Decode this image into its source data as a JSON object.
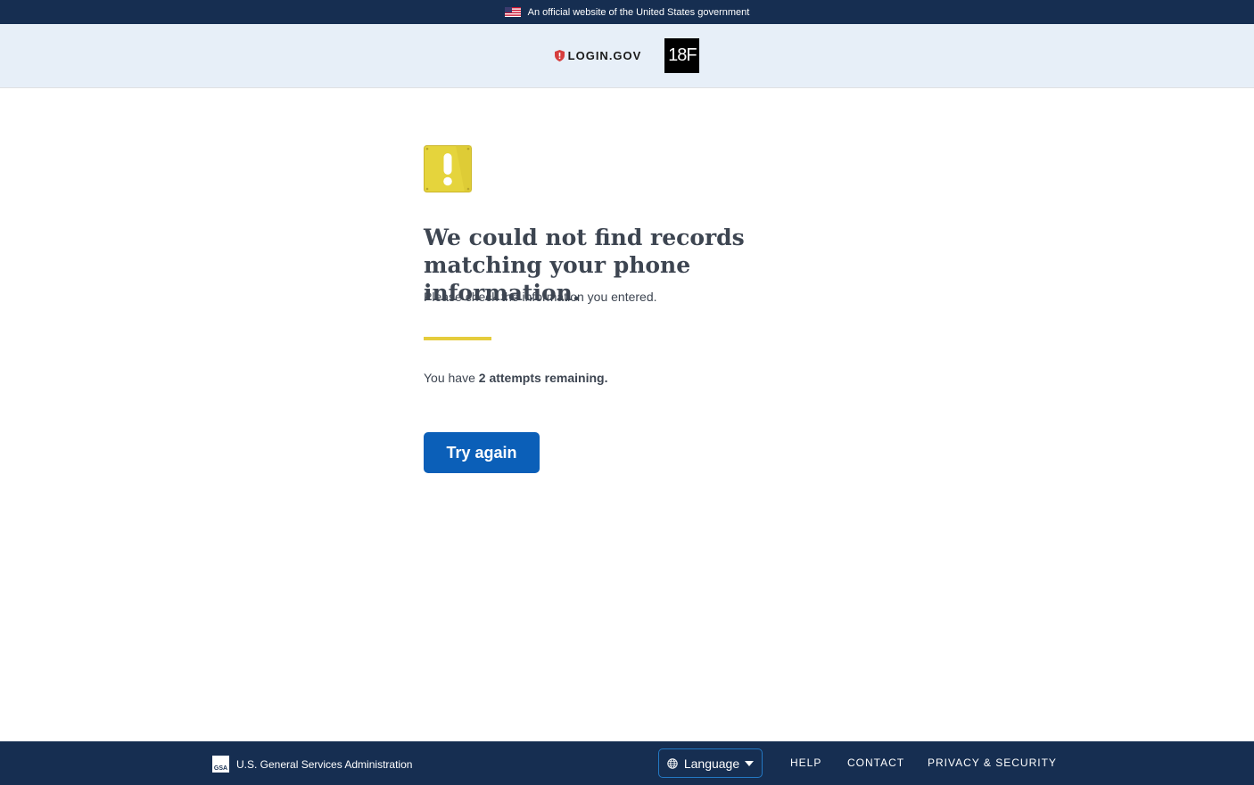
{
  "gov_banner": {
    "text": "An official website of the United States government"
  },
  "header": {
    "login_logo_text": "LOGIN.GOV",
    "partner_logo_text": "18F"
  },
  "main": {
    "heading": "We could not find records matching your phone information.",
    "subtext": "Please check the information you entered.",
    "attempts_prefix": "You have ",
    "attempts_bold": "2 attempts remaining.",
    "try_again_label": "Try again"
  },
  "footer": {
    "gsa_logo_text": "GSA",
    "gsa_text": "U.S. General Services Administration",
    "language_label": "Language",
    "links": [
      {
        "label": "Help"
      },
      {
        "label": "Contact"
      },
      {
        "label": "Privacy & Security"
      }
    ]
  },
  "colors": {
    "banner_bg": "#162e51",
    "header_bg": "#e7eff8",
    "primary_button": "#0b5fb8",
    "accent_divider": "#e5cc3c",
    "warning_icon": "#e5d43c"
  },
  "icons": {
    "flag": "us-flag-icon",
    "shield": "login-shield-icon",
    "warning": "warning-exclamation-icon",
    "globe": "globe-icon",
    "caret": "caret-down-icon"
  }
}
